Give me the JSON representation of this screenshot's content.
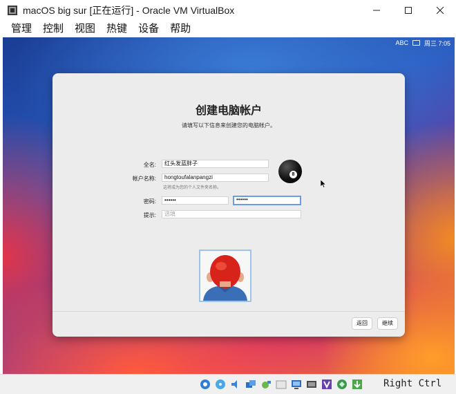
{
  "window": {
    "title": "macOS big sur [正在运行] - Oracle VM VirtualBox"
  },
  "menu": [
    "管理",
    "控制",
    "视图",
    "热键",
    "设备",
    "帮助"
  ],
  "mac_menubar": {
    "input_source": "ABC",
    "time": "周三 7:05"
  },
  "setup": {
    "title": "创建电脑帐户",
    "subtitle": "请填写以下信息来创建您的电脑帐户。",
    "full_name_label": "全名:",
    "full_name_value": "红头发蓝胖子",
    "account_name_label": "帐户名称:",
    "account_name_value": "hongtoufalanpangzi",
    "account_hint": "这将成为您的个人文件夹名称。",
    "password_label": "密码:",
    "password_value": "••••••",
    "verify_value": "••••••",
    "hint_label": "提示:",
    "hint_placeholder": "选填",
    "avatar_ball_number": "8",
    "back_button": "返回",
    "continue_button": "继续"
  },
  "statusbar": {
    "host_key": "Right Ctrl"
  },
  "colors": {
    "focus_ring": "#6a9be6",
    "panel_bg": "#ececec"
  }
}
